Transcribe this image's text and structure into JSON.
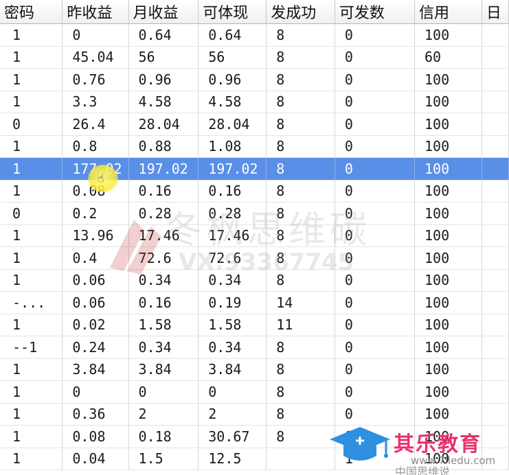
{
  "columns": [
    "密码",
    "昨收益",
    "月收益",
    "可体现",
    "发成功",
    "可发数",
    "信用",
    "日"
  ],
  "rows": [
    [
      "1",
      "0",
      "0.64",
      "0.64",
      "8",
      "0",
      "100",
      ""
    ],
    [
      "1",
      "45.04",
      "56",
      "56",
      "8",
      "0",
      "60",
      ""
    ],
    [
      "1",
      "0.76",
      "0.96",
      "0.96",
      "8",
      "0",
      "100",
      ""
    ],
    [
      "1",
      "3.3",
      "4.58",
      "4.58",
      "8",
      "0",
      "100",
      ""
    ],
    [
      "0",
      "26.4",
      "28.04",
      "28.04",
      "8",
      "0",
      "100",
      ""
    ],
    [
      "1",
      "0.8",
      "0.88",
      "1.08",
      "8",
      "0",
      "100",
      ""
    ],
    [
      "1",
      "177.02",
      "197.02",
      "197.02",
      "8",
      "0",
      "100",
      ""
    ],
    [
      "1",
      "0.08",
      "0.16",
      "0.16",
      "8",
      "0",
      "100",
      ""
    ],
    [
      "0",
      "0.2",
      "0.28",
      "0.28",
      "8",
      "0",
      "100",
      ""
    ],
    [
      "1",
      "13.96",
      "17.46",
      "17.46",
      "8",
      "0",
      "100",
      ""
    ],
    [
      "1",
      "0.4",
      "72.6",
      "72.6",
      "8",
      "0",
      "100",
      ""
    ],
    [
      "1",
      "0.06",
      "0.34",
      "0.34",
      "8",
      "0",
      "100",
      ""
    ],
    [
      "-...",
      "0.06",
      "0.16",
      "0.19",
      "14",
      "0",
      "100",
      ""
    ],
    [
      "1",
      "0.02",
      "1.58",
      "1.58",
      "11",
      "0",
      "100",
      ""
    ],
    [
      "--1",
      "0.24",
      "0.34",
      "0.34",
      "8",
      "0",
      "100",
      ""
    ],
    [
      "1",
      "3.84",
      "3.84",
      "3.84",
      "8",
      "0",
      "100",
      ""
    ],
    [
      "1",
      "0",
      "0",
      "0",
      "8",
      "0",
      "100",
      ""
    ],
    [
      "1",
      "0.36",
      "2",
      "2",
      "8",
      "0",
      "100",
      ""
    ],
    [
      "1",
      "0.08",
      "0.18",
      "30.67",
      "8",
      "0",
      "100",
      ""
    ],
    [
      "1",
      "0.04",
      "1.5",
      "12.5",
      "",
      "1",
      "100",
      ""
    ]
  ],
  "selected_row": 6,
  "watermark": {
    "text": "冬枫思维碳",
    "sub": "VX:93367745"
  },
  "brand": {
    "name": "其乐教育",
    "url": "www.7lledu.com"
  },
  "bottom_text": "中国思维说",
  "colors": {
    "selection": "#5a8fe8",
    "brand_pink": "#e8336b",
    "brand_blue": "#2f8fe0"
  }
}
